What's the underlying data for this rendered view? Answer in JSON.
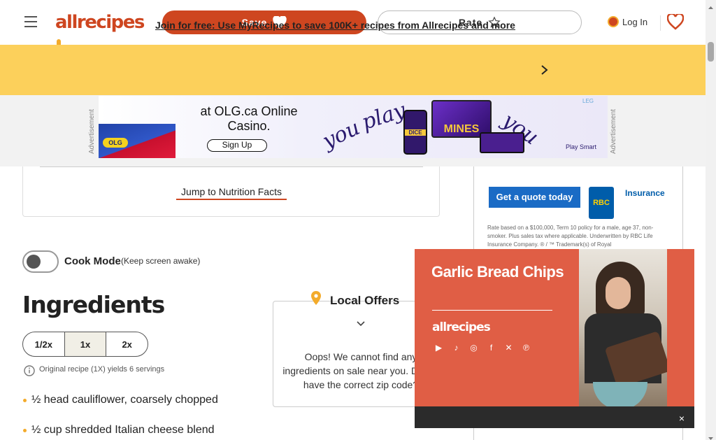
{
  "header": {
    "logo_text": "allrecipes",
    "save_label": "Save",
    "rate_label": "Rate",
    "login_label": "Log In"
  },
  "promo": {
    "text": "Join for free: Use MyRecipes to save 100K+ recipes from Allrecipes and more"
  },
  "ad_banner": {
    "label": "Advertisement",
    "headline": "at OLG.ca Online Casino.",
    "button": "Sign Up",
    "brand": "OLG",
    "play_words": [
      "you",
      "play",
      "you"
    ],
    "game": "MINES",
    "dice": "DICE",
    "footer": "Play Smart",
    "corner": "LEG"
  },
  "recipe": {
    "jump_link": "Jump to Nutrition Facts",
    "cook_mode_label": "Cook Mode",
    "cook_mode_note": "(Keep screen awake)",
    "ingredients_title": "Ingredients",
    "scale_options": [
      "1/2x",
      "1x",
      "2x"
    ],
    "scale_note": "Original recipe (1X) yields 6 servings",
    "ingredients": [
      "½ head cauliflower, coarsely chopped",
      "½ cup shredded Italian cheese blend"
    ]
  },
  "local_offers": {
    "title": "Local Offers",
    "message": "Oops! We cannot find any ingredients on sale near you. Do we have the correct zip code?"
  },
  "sidebar_ad": {
    "button": "Get a quote today",
    "brand": "RBC",
    "product": "Insurance",
    "fine_print": "Rate based on a $100,000, Term 10 policy for a male, age 37, non-smoker. Plus sales tax where applicable. Underwritten by RBC Life Insurance Company. ® / ™ Trademark(s) of Royal"
  },
  "video": {
    "title": "Garlic Bread Chips",
    "logo": "allrecipes",
    "socials": [
      "youtube",
      "tiktok",
      "instagram",
      "facebook",
      "x",
      "pinterest"
    ],
    "close": "×"
  },
  "colors": {
    "brand_orange": "#ce4620",
    "promo_yellow": "#fcd05b",
    "video_bg": "#e05e45"
  }
}
